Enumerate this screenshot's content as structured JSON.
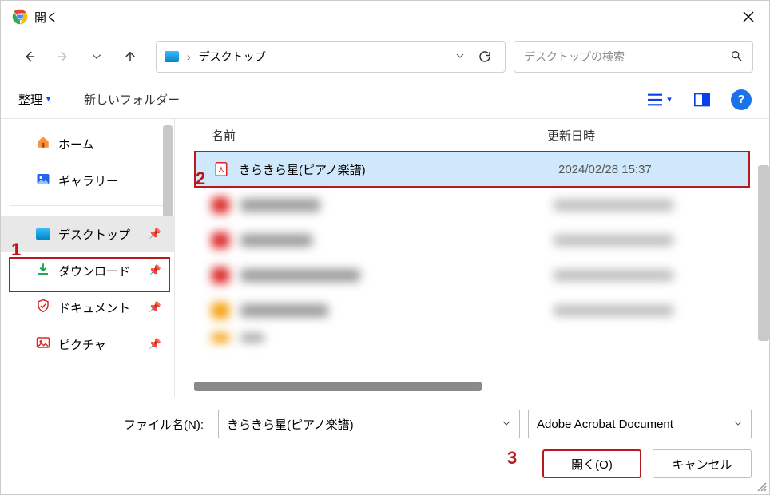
{
  "title": "開く",
  "nav": {
    "breadcrumb_prefix": "›",
    "breadcrumb": "デスクトップ"
  },
  "search": {
    "placeholder": "デスクトップの検索"
  },
  "toolbar": {
    "organize": "整理",
    "new_folder": "新しいフォルダー"
  },
  "sidebar": {
    "home": "ホーム",
    "gallery": "ギャラリー",
    "desktop": "デスクトップ",
    "downloads": "ダウンロード",
    "documents": "ドキュメント",
    "pictures": "ピクチャ"
  },
  "columns": {
    "name": "名前",
    "date": "更新日時"
  },
  "files": {
    "selected": {
      "name": "きらきら星(ピアノ楽譜)",
      "date": "2024/02/28 15:37"
    }
  },
  "footer": {
    "filename_label": "ファイル名(N):",
    "filename_value": "きらきら星(ピアノ楽譜)",
    "filetype": "Adobe Acrobat Document",
    "open": "開く(O)",
    "cancel": "キャンセル"
  },
  "callouts": {
    "c1": "1",
    "c2": "2",
    "c3": "3"
  }
}
